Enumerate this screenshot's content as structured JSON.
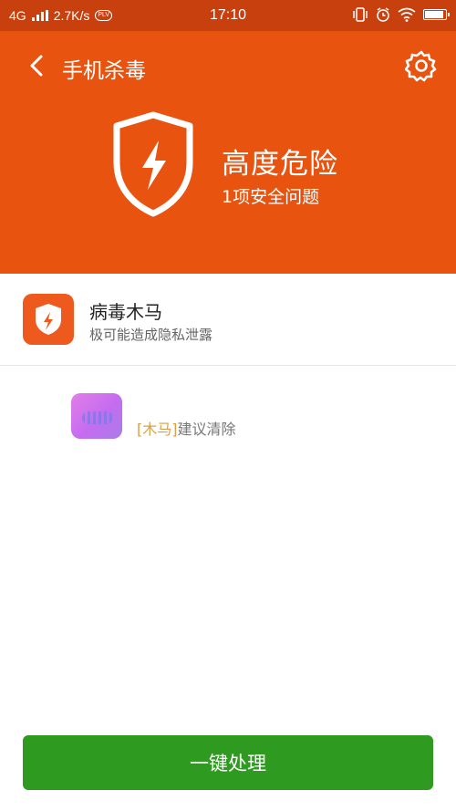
{
  "status_bar": {
    "network": "4G",
    "speed": "2.7K/s",
    "badge": "PLV",
    "time": "17:10",
    "icons": [
      "signal-icon",
      "vibrate-icon",
      "alarm-icon",
      "wifi-icon",
      "battery-icon"
    ],
    "battery_level": 0.85
  },
  "header": {
    "title": "手机杀毒",
    "danger_title": "高度危险",
    "danger_subtitle": "1项安全问题"
  },
  "items": [
    {
      "name": "病毒木马",
      "desc": "极可能造成隐私泄露"
    },
    {
      "badge": "木马",
      "desc": "建议清除"
    }
  ],
  "action_button": {
    "label": "一键处理"
  },
  "colors": {
    "status_bar": "#c8400e",
    "header": "#e8530f",
    "icon_orange": "#ee5a1e",
    "button_green": "#2e9a1f"
  }
}
